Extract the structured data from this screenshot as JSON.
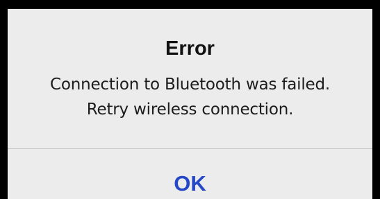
{
  "alert": {
    "title": "Error",
    "message_lines": [
      "Connection to Bluetooth was failed.",
      "Retry wireless connection."
    ],
    "ok_label": "OK"
  },
  "colors": {
    "background": "#000000",
    "dialog": "#ececec",
    "title_text": "#111111",
    "button_text": "#2448c7",
    "divider": "#c4c4c4"
  }
}
